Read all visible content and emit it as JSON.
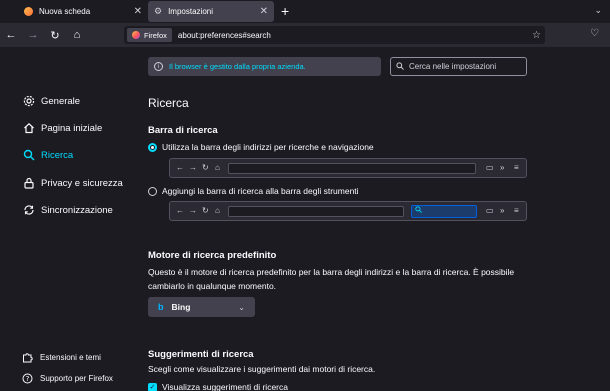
{
  "tabs": [
    {
      "label": "Nuova scheda",
      "favicon_color": "#ff7139"
    },
    {
      "label": "Impostazioni",
      "favicon_color": "#cfcfd8"
    }
  ],
  "toolbar": {
    "identity_label": "Firefox",
    "url": "about:preferences#search"
  },
  "sidebar": {
    "items": [
      {
        "label": "Generale",
        "icon": "gear-icon"
      },
      {
        "label": "Pagina iniziale",
        "icon": "home-icon"
      },
      {
        "label": "Ricerca",
        "icon": "search-icon",
        "active": true
      },
      {
        "label": "Privacy e sicurezza",
        "icon": "lock-icon"
      },
      {
        "label": "Sincronizzazione",
        "icon": "sync-icon"
      }
    ],
    "footer": [
      {
        "label": "Estensioni e temi",
        "icon": "puzzle-icon"
      },
      {
        "label": "Supporto per Firefox",
        "icon": "help-icon"
      }
    ]
  },
  "policy_notice": "Il browser è gestito dalla propria azienda.",
  "search_placeholder": "Cerca nelle impostazioni",
  "main": {
    "title": "Ricerca",
    "searchbar_heading": "Barra di ricerca",
    "option_urlbar": "Utilizza la barra degli indirizzi per ricerche e navigazione",
    "option_searchbar": "Aggiungi la barra di ricerca alla barra degli strumenti",
    "selected_option": "option_urlbar",
    "engine_heading": "Motore di ricerca predefinito",
    "engine_desc": "Questo è il motore di ricerca predefinito per la barra degli indirizzi e la barra di ricerca. È possibile cambiarlo in qualunque momento.",
    "engine_value": "Bing",
    "suggest_heading": "Suggerimenti di ricerca",
    "suggest_desc": "Scegli come visualizzare i suggerimenti dai motori di ricerca.",
    "suggest_check": "Visualizza suggerimenti di ricerca",
    "suggest_checked": true
  },
  "colors": {
    "accent": "#00ddff",
    "background": "#1c1b22",
    "toolbar": "#2b2a33",
    "control": "#42414d"
  }
}
